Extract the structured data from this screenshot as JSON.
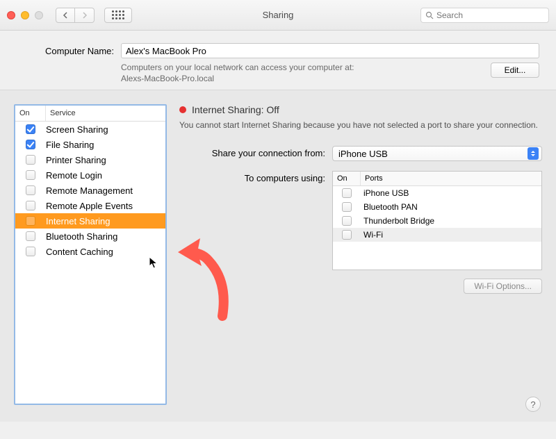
{
  "window": {
    "title": "Sharing",
    "search_placeholder": "Search"
  },
  "computer_name": {
    "label": "Computer Name:",
    "value": "Alex's MacBook Pro",
    "hint_line1": "Computers on your local network can access your computer at:",
    "hint_line2": "Alexs-MacBook-Pro.local",
    "edit_button": "Edit..."
  },
  "services": {
    "header_on": "On",
    "header_service": "Service",
    "items": [
      {
        "label": "Screen Sharing",
        "checked": true
      },
      {
        "label": "File Sharing",
        "checked": true
      },
      {
        "label": "Printer Sharing",
        "checked": false
      },
      {
        "label": "Remote Login",
        "checked": false
      },
      {
        "label": "Remote Management",
        "checked": false
      },
      {
        "label": "Remote Apple Events",
        "checked": false
      },
      {
        "label": "Internet Sharing",
        "checked": false,
        "selected": true
      },
      {
        "label": "Bluetooth Sharing",
        "checked": false
      },
      {
        "label": "Content Caching",
        "checked": false
      }
    ]
  },
  "detail": {
    "status_title": "Internet Sharing: Off",
    "status_color": "#e63131",
    "status_desc": "You cannot start Internet Sharing because you have not selected a port to share your connection.",
    "share_from_label": "Share your connection from:",
    "share_from_value": "iPhone USB",
    "to_computers_label": "To computers using:",
    "ports_header_on": "On",
    "ports_header_ports": "Ports",
    "ports": [
      {
        "label": "iPhone USB",
        "checked": false
      },
      {
        "label": "Bluetooth PAN",
        "checked": false
      },
      {
        "label": "Thunderbolt Bridge",
        "checked": false
      },
      {
        "label": "Wi-Fi",
        "checked": false,
        "highlight": true
      }
    ],
    "wifi_options": "Wi‑Fi Options..."
  },
  "help": "?"
}
